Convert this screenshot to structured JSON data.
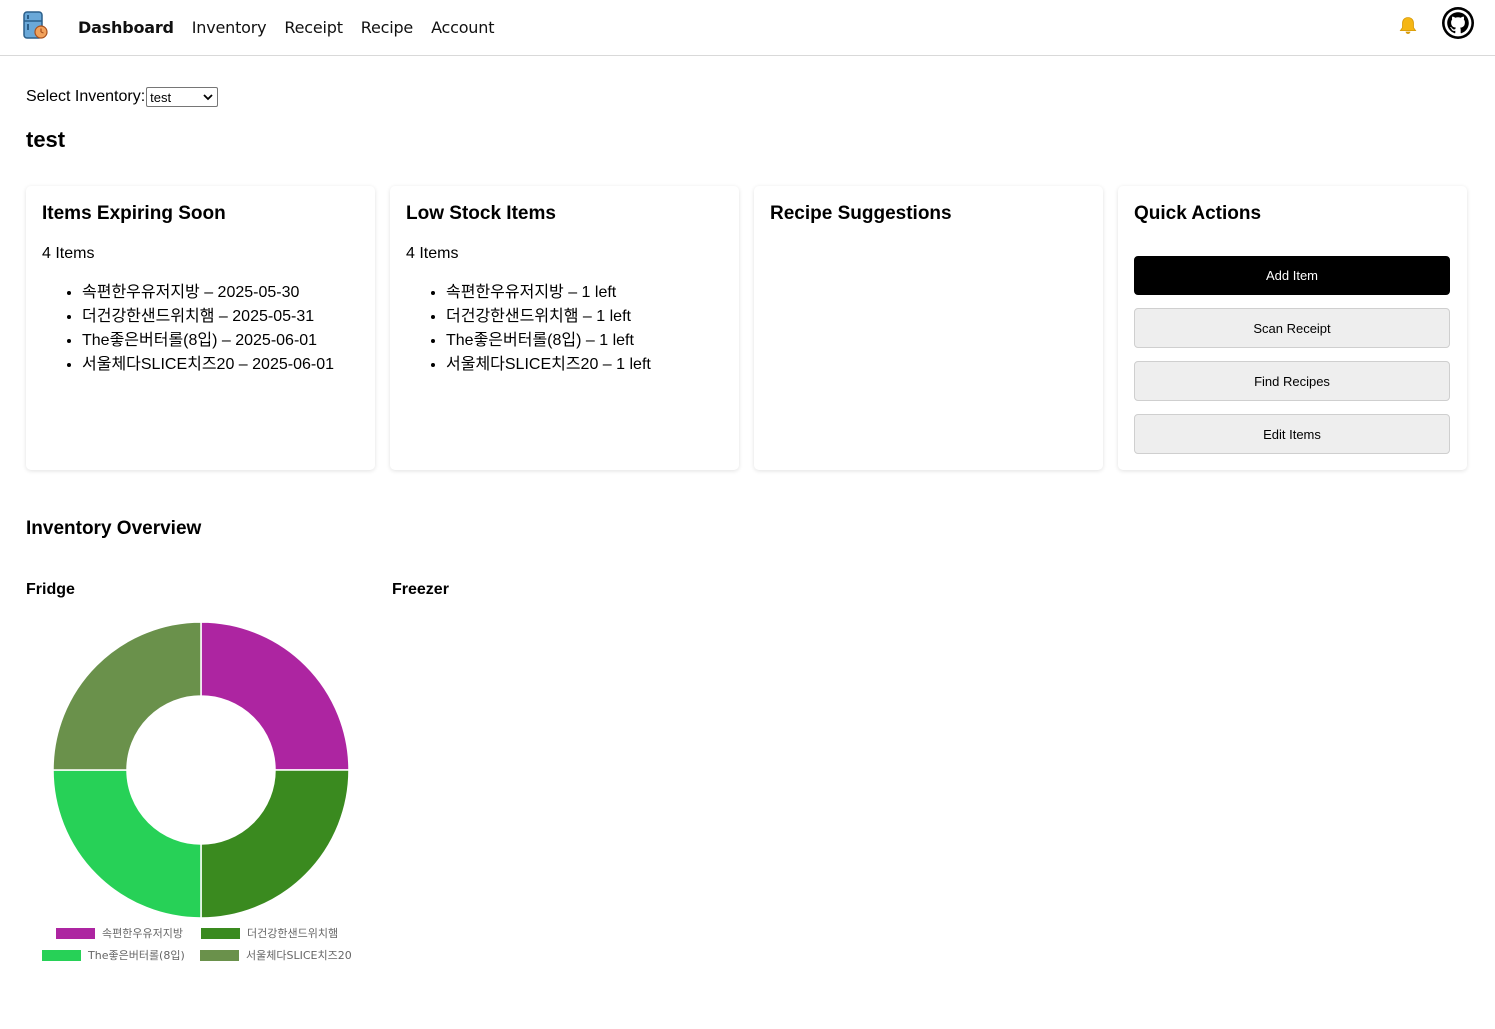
{
  "nav": {
    "logo_icon": "fridge-logo-icon",
    "links": [
      "Dashboard",
      "Inventory",
      "Receipt",
      "Recipe",
      "Account"
    ],
    "active": "Dashboard",
    "bell_icon": "bell-icon",
    "github_icon": "github-icon"
  },
  "inventory_select": {
    "label": "Select Inventory:",
    "value": "test"
  },
  "inventory_title": "test",
  "cards": {
    "expiring": {
      "title": "Items Expiring Soon",
      "count": "4 Items",
      "items": [
        "속편한우유저지방 – 2025-05-30",
        "더건강한샌드위치햄 – 2025-05-31",
        "The좋은버터롤(8입) – 2025-06-01",
        "서울체다SLICE치즈20 – 2025-06-01"
      ]
    },
    "low_stock": {
      "title": "Low Stock Items",
      "count": "4 Items",
      "items": [
        "속편한우유저지방 – 1 left",
        "더건강한샌드위치햄 – 1 left",
        "The좋은버터롤(8입) – 1 left",
        "서울체다SLICE치즈20 – 1 left"
      ]
    },
    "recipes": {
      "title": "Recipe Suggestions"
    },
    "quick_actions": {
      "title": "Quick Actions",
      "buttons": [
        "Add Item",
        "Scan Receipt",
        "Find Recipes",
        "Edit Items"
      ]
    }
  },
  "overview": {
    "title": "Inventory Overview",
    "storages": [
      "Fridge",
      "Freezer"
    ]
  },
  "chart_data": {
    "type": "pie",
    "variant": "doughnut",
    "title": "",
    "categories": [
      "속편한우유저지방",
      "더건강한샌드위치햄",
      "The좋은버터롤(8입)",
      "서울체다SLICE치즈20"
    ],
    "values": [
      1,
      1,
      1,
      1
    ],
    "colors": [
      "#ad25a1",
      "#3a8a1f",
      "#27d157",
      "#6a914b"
    ],
    "legend_position": "bottom"
  }
}
